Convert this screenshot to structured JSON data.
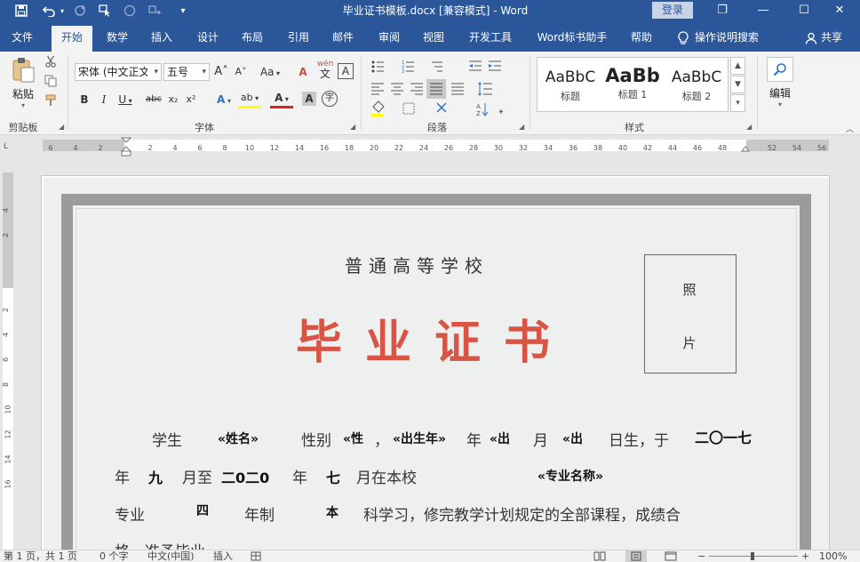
{
  "title": {
    "document_title": "毕业证书模板.docx [兼容模式] - Word",
    "login_label": "登录",
    "window_controls": {
      "restore": "❐",
      "minimize": "—",
      "maximize": "☐",
      "close": "✕"
    }
  },
  "menu": {
    "tabs": [
      {
        "label": "文件"
      },
      {
        "label": "开始"
      },
      {
        "label": "数学"
      },
      {
        "label": "插入"
      },
      {
        "label": "设计"
      },
      {
        "label": "布局"
      },
      {
        "label": "引用"
      },
      {
        "label": "邮件"
      },
      {
        "label": "审阅"
      },
      {
        "label": "视图"
      },
      {
        "label": "开发工具"
      },
      {
        "label": "Word标书助手"
      },
      {
        "label": "帮助"
      }
    ],
    "active_tab": "开始",
    "tell_me": "操作说明搜索",
    "share": "共享"
  },
  "ribbon": {
    "clipboard": {
      "label": "剪贴板",
      "paste_label": "粘贴"
    },
    "font": {
      "label": "字体",
      "font_name": "宋体 (中文正文",
      "font_size": "五号",
      "grow": "A˄",
      "shrink": "A˅",
      "change_case": "Aa",
      "clear_format": "A",
      "phonetic": "wén",
      "phonetic_char": "文",
      "border_char": "A",
      "bold": "B",
      "italic": "I",
      "underline": "U",
      "strike": "abc",
      "subscript": "x₂",
      "superscript": "x²",
      "text_effect": "A",
      "highlight": "ab",
      "font_color": "A",
      "char_shading": "A",
      "enclose": "字"
    },
    "paragraph": {
      "label": "段落"
    },
    "styles": {
      "label": "样式",
      "items": [
        {
          "sample": "AaBbC",
          "name": "标题"
        },
        {
          "sample": "AaBb",
          "name": "标题 1"
        },
        {
          "sample": "AaBbC",
          "name": "标题 2"
        }
      ]
    },
    "editing": {
      "label": "编辑"
    }
  },
  "ruler": {
    "corner": "L",
    "ticks": [
      "6",
      "4",
      "2",
      "2",
      "4",
      "6",
      "8",
      "10",
      "12",
      "14",
      "16",
      "18",
      "20",
      "22",
      "24",
      "26",
      "28",
      "30",
      "32",
      "34",
      "36",
      "38",
      "40",
      "42",
      "44",
      "46",
      "48",
      "52",
      "54",
      "56"
    ],
    "vticks": [
      "4",
      "2",
      "2",
      "4",
      "6",
      "8",
      "10",
      "12",
      "14",
      "16"
    ]
  },
  "certificate": {
    "school": "普通高等学校",
    "title": "毕业证书",
    "photo": [
      "照",
      "片"
    ],
    "line1": {
      "student": "学生",
      "name_field": "«姓名»",
      "gender": "性别",
      "gender_field": "«性",
      "comma": "，",
      "birth_year_field": "«出生年»",
      "year": "年",
      "month_field": "«出",
      "month": "月",
      "day_field": "«出",
      "birth_suffix": "日生，于",
      "start_year": "二〇一七"
    },
    "line2": {
      "year": "年",
      "start_month": "九",
      "month_to": "月至",
      "end_year": "二0二0",
      "year2": "年",
      "end_month": "七",
      "month_at_school": "月在本校",
      "major_field": "«专业名称»"
    },
    "line3": {
      "major": "专业",
      "years_value": "四",
      "years_label": "年制",
      "level": "本",
      "description": "科学习，修完教学计划规定的全部课程，成绩合"
    },
    "line4": {
      "text": "格，准予毕业。"
    }
  },
  "statusbar": {
    "page": "第 1 页，共 1 页",
    "words": "0 个字",
    "language": "中文(中国)",
    "mode": "插入",
    "zoom": "100%",
    "zoom_minus": "−",
    "zoom_plus": "+"
  }
}
